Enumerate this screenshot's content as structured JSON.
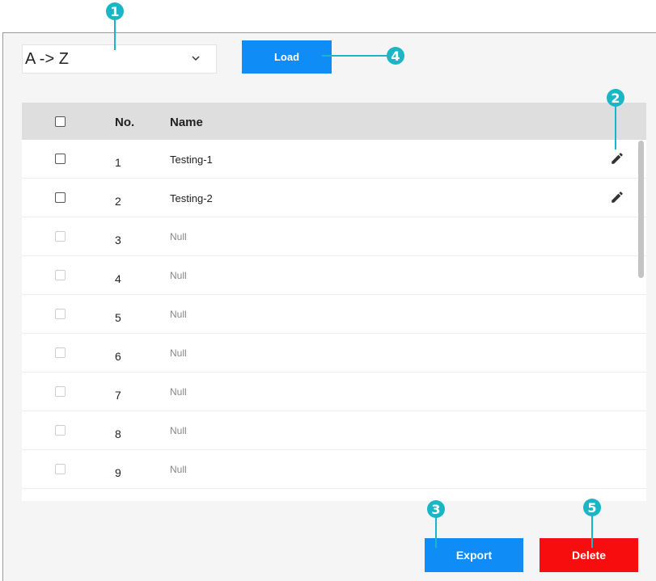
{
  "sort": {
    "value": "A -> Z"
  },
  "buttons": {
    "load": "Load",
    "export": "Export",
    "delete": "Delete"
  },
  "table": {
    "headers": {
      "no": "No.",
      "name": "Name"
    },
    "rows": [
      {
        "no": "1",
        "name": "Testing-1",
        "editable": true
      },
      {
        "no": "2",
        "name": "Testing-2",
        "editable": true
      },
      {
        "no": "3",
        "name": "Null",
        "editable": false
      },
      {
        "no": "4",
        "name": "Null",
        "editable": false
      },
      {
        "no": "5",
        "name": "Null",
        "editable": false
      },
      {
        "no": "6",
        "name": "Null",
        "editable": false
      },
      {
        "no": "7",
        "name": "Null",
        "editable": false
      },
      {
        "no": "8",
        "name": "Null",
        "editable": false
      },
      {
        "no": "9",
        "name": "Null",
        "editable": false
      }
    ]
  },
  "callouts": [
    "1",
    "2",
    "3",
    "4",
    "5"
  ],
  "icons": {
    "dropdown": "chevron-down-icon",
    "edit": "pencil-icon"
  },
  "colors": {
    "primary": "#0f8cf5",
    "danger": "#f70d0d",
    "callout": "#1ab6c5"
  }
}
